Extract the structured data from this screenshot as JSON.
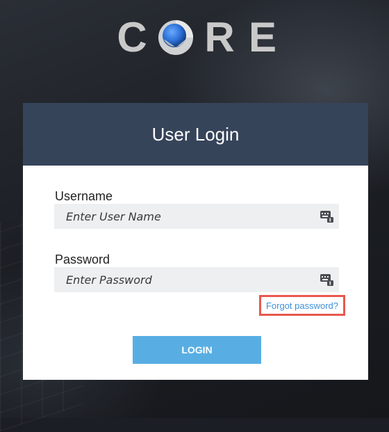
{
  "logo": {
    "letters": [
      "C",
      "R",
      "E"
    ]
  },
  "card": {
    "title": "User Login"
  },
  "username": {
    "label": "Username",
    "placeholder": "Enter User Name",
    "value": ""
  },
  "password": {
    "label": "Password",
    "placeholder": "Enter Password",
    "value": ""
  },
  "forgot_password": "Forgot password?",
  "login_button": "LOGIN",
  "icons": {
    "field_icon": "keyboard-icon",
    "logo_orb": "sphere-logo-icon"
  },
  "colors": {
    "header_bg": "#36445a",
    "button_bg": "#58aee3",
    "link": "#3d8fd8",
    "highlight_border": "#e8584e",
    "logo_letters": "#c9c9c9",
    "logo_orb": "#2b6fd6"
  }
}
